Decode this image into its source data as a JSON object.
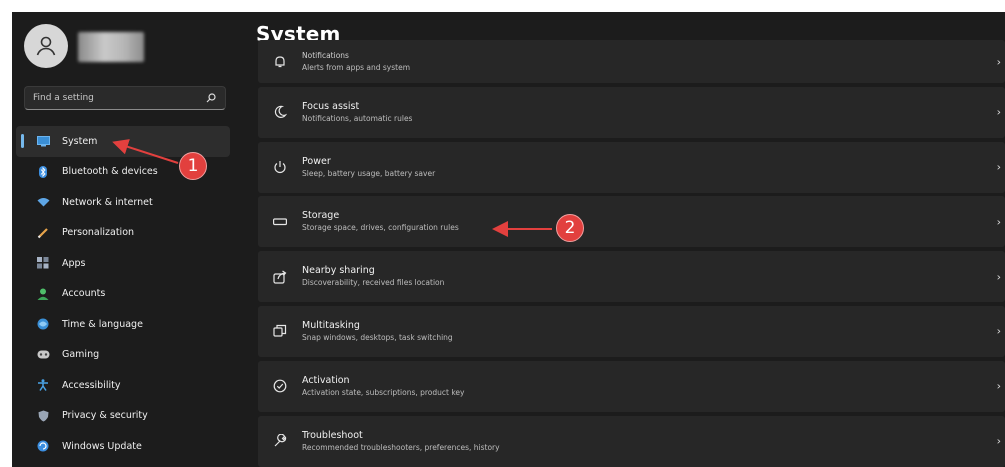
{
  "sidebar": {
    "search_placeholder": "Find a setting",
    "items": [
      {
        "label": "System",
        "icon": "monitor-icon",
        "selected": true
      },
      {
        "label": "Bluetooth & devices",
        "icon": "bluetooth-icon"
      },
      {
        "label": "Network & internet",
        "icon": "wifi-icon"
      },
      {
        "label": "Personalization",
        "icon": "brush-icon"
      },
      {
        "label": "Apps",
        "icon": "apps-icon"
      },
      {
        "label": "Accounts",
        "icon": "person-icon"
      },
      {
        "label": "Time & language",
        "icon": "globe-clock-icon"
      },
      {
        "label": "Gaming",
        "icon": "gamepad-icon"
      },
      {
        "label": "Accessibility",
        "icon": "accessibility-icon"
      },
      {
        "label": "Privacy & security",
        "icon": "shield-icon"
      },
      {
        "label": "Windows Update",
        "icon": "update-icon"
      }
    ]
  },
  "main": {
    "title": "System",
    "rows": [
      {
        "title": "Notifications",
        "subtitle": "Alerts from apps and system",
        "icon": "bell-icon"
      },
      {
        "title": "Focus assist",
        "subtitle": "Notifications, automatic rules",
        "icon": "moon-icon"
      },
      {
        "title": "Power",
        "subtitle": "Sleep, battery usage, battery saver",
        "icon": "power-icon"
      },
      {
        "title": "Storage",
        "subtitle": "Storage space, drives, configuration rules",
        "icon": "storage-drive-icon"
      },
      {
        "title": "Nearby sharing",
        "subtitle": "Discoverability, received files location",
        "icon": "share-icon"
      },
      {
        "title": "Multitasking",
        "subtitle": "Snap windows, desktops, task switching",
        "icon": "multitask-icon"
      },
      {
        "title": "Activation",
        "subtitle": "Activation state, subscriptions, product key",
        "icon": "check-circle-icon"
      },
      {
        "title": "Troubleshoot",
        "subtitle": "Recommended troubleshooters, preferences, history",
        "icon": "wrench-icon"
      }
    ]
  },
  "annotations": {
    "badge1": "1",
    "badge2": "2",
    "color": "#e2403e"
  },
  "colors": {
    "background": "#1c1c1c",
    "card": "#272727",
    "accent": "#76b9ed"
  }
}
